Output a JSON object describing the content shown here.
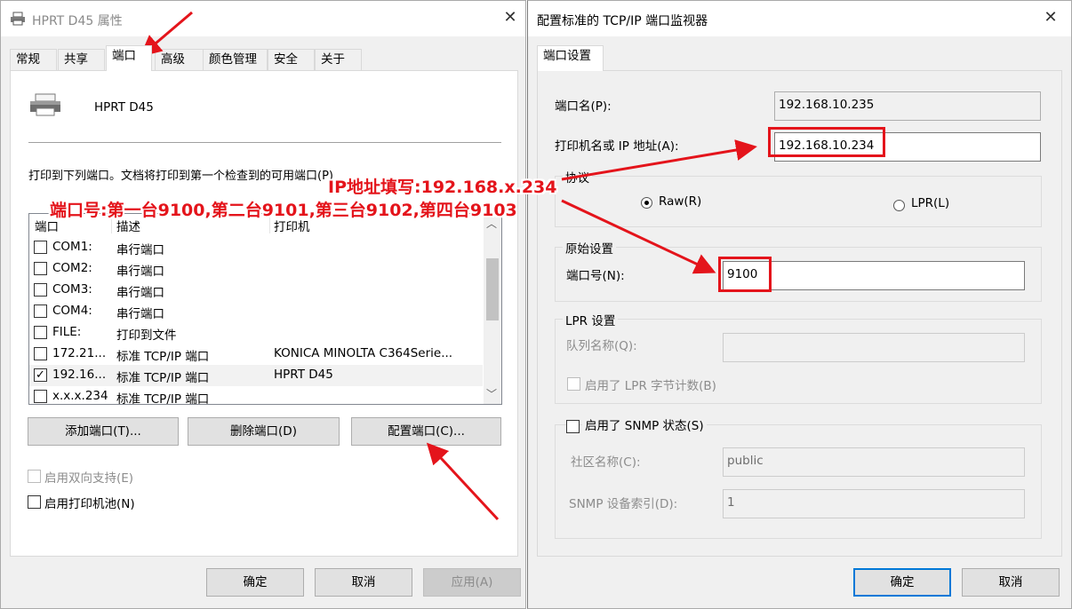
{
  "left_dialog": {
    "title": "HPRT D45 属性",
    "close": "✕",
    "tabs": [
      "常规",
      "共享",
      "端口",
      "高级",
      "颜色管理",
      "安全",
      "关于"
    ],
    "printer_name": "HPRT D45",
    "instruction": "打印到下列端口。文档将打印到第一个检查到的可用端口(P)",
    "port_list": {
      "columns": [
        "端口",
        "描述",
        "打印机"
      ],
      "rows": [
        {
          "port": "COM1:",
          "desc": "串行端口",
          "printer": "",
          "checked": false
        },
        {
          "port": "COM2:",
          "desc": "串行端口",
          "printer": "",
          "checked": false
        },
        {
          "port": "COM3:",
          "desc": "串行端口",
          "printer": "",
          "checked": false
        },
        {
          "port": "COM4:",
          "desc": "串行端口",
          "printer": "",
          "checked": false
        },
        {
          "port": "FILE:",
          "desc": "打印到文件",
          "printer": "",
          "checked": false
        },
        {
          "port": "172.21...",
          "desc": "标准 TCP/IP 端口",
          "printer": "KONICA MINOLTA C364Serie...",
          "checked": false
        },
        {
          "port": "192.16...",
          "desc": "标准 TCP/IP 端口",
          "printer": "HPRT D45",
          "checked": true
        },
        {
          "port": "x.x.x.234",
          "desc": "标准 TCP/IP 端口",
          "printer": "",
          "checked": false
        }
      ]
    },
    "buttons": {
      "add_port": "添加端口(T)...",
      "delete_port": "删除端口(D)",
      "configure_port": "配置端口(C)..."
    },
    "bidirectional": "启用双向支持(E)",
    "pooling": "启用打印机池(N)",
    "footer": {
      "ok": "确定",
      "cancel": "取消",
      "apply": "应用(A)"
    }
  },
  "right_dialog": {
    "title": "配置标准的 TCP/IP 端口监视器",
    "close": "✕",
    "tab": "端口设置",
    "port_name_label": "端口名(P):",
    "port_name_value": "192.168.10.235",
    "address_label": "打印机名或 IP 地址(A):",
    "address_value": "192.168.10.234",
    "protocol_group": "协议",
    "raw_label": "Raw(R)",
    "lpr_label": "LPR(L)",
    "raw_settings_group": "原始设置",
    "port_number_label": "端口号(N):",
    "port_number_value": "9100",
    "lpr_group": "LPR 设置",
    "queue_label": "队列名称(Q):",
    "queue_value": "",
    "lpr_byte_count": "启用了 LPR 字节计数(B)",
    "snmp_label": "启用了 SNMP 状态(S)",
    "community_label": "社区名称(C):",
    "community_value": "public",
    "snmp_index_label": "SNMP 设备索引(D):",
    "snmp_index_value": "1",
    "footer": {
      "ok": "确定",
      "cancel": "取消"
    }
  },
  "annotations": {
    "ip_hint": "IP地址填写:192.168.x.234",
    "port_hint": "端口号:第一台9100,第二台9101,第三台9102,第四台9103"
  },
  "colors": {
    "annotation_red": "#e4141b",
    "focus_blue": "#0078d7"
  },
  "icons": {
    "printer": "printer-icon",
    "check": "✓",
    "scroll_up": "︿",
    "scroll_down": "﹀"
  }
}
